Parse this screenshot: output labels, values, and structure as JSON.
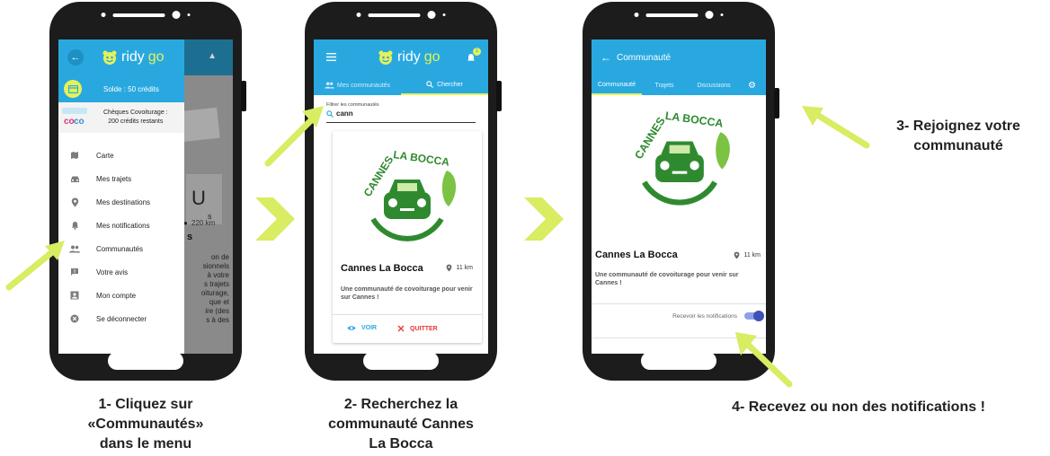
{
  "colors": {
    "brand": "#29a8e0",
    "accent_green": "#d9ec62",
    "danger": "#e53935",
    "logo_green": "#4b8d2f"
  },
  "brand": {
    "prefix": "ridy",
    "suffix": "go"
  },
  "phone1": {
    "balance": "Solde : 50 crédits",
    "cheques_line1": "Chèques Covoiturage :",
    "cheques_line2": "200 crédits restants",
    "menu": [
      {
        "label": "Carte",
        "icon": "map-icon"
      },
      {
        "label": "Mes trajets",
        "icon": "car-icon"
      },
      {
        "label": "Mes destinations",
        "icon": "place-icon"
      },
      {
        "label": "Mes notifications",
        "icon": "bell-icon"
      },
      {
        "label": "Communautés",
        "icon": "people-icon"
      },
      {
        "label": "Votre avis",
        "icon": "feedback-icon"
      },
      {
        "label": "Mon compte",
        "icon": "account-icon"
      },
      {
        "label": "Se déconnecter",
        "icon": "logout-icon"
      }
    ],
    "bg_distance": "220 km",
    "bg_letters": "U",
    "bg_s": "s",
    "bg_text": [
      "on de",
      "sionnels",
      "à votre",
      "s trajets",
      "oiturage,",
      "que et",
      "ire (des",
      "s à des"
    ]
  },
  "phone2": {
    "notif_badge": "1",
    "tab_communities": "Mes communautés",
    "tab_search": "Chercher",
    "filter_label": "Filtrer les communautés",
    "filter_value": "cann",
    "card_title": "Cannes La Bocca",
    "card_distance": "11 km",
    "card_description": "Une communauté de covoiturage pour venir sur Cannes !",
    "btn_view": "VOIR",
    "btn_quit": "QUITTER"
  },
  "phone3": {
    "title": "Communauté",
    "tabs": [
      "Communauté",
      "Trajets",
      "Discussions"
    ],
    "name": "Cannes La Bocca",
    "distance": "11 km",
    "description": "Une communauté de covoiturage pour venir sur Cannes !",
    "notif_label": "Recevoir les notifications"
  },
  "logo_text": "CANNES LA BOCCA",
  "captions": {
    "step1": [
      "1- Cliquez sur",
      "«Communautés»",
      "dans le menu"
    ],
    "step2": [
      "2- Recherchez la",
      "communauté Cannes",
      "La Bocca"
    ],
    "step3": [
      "3- Rejoignez votre",
      "communauté"
    ],
    "step4": "4- Recevez ou non des notifications !"
  }
}
